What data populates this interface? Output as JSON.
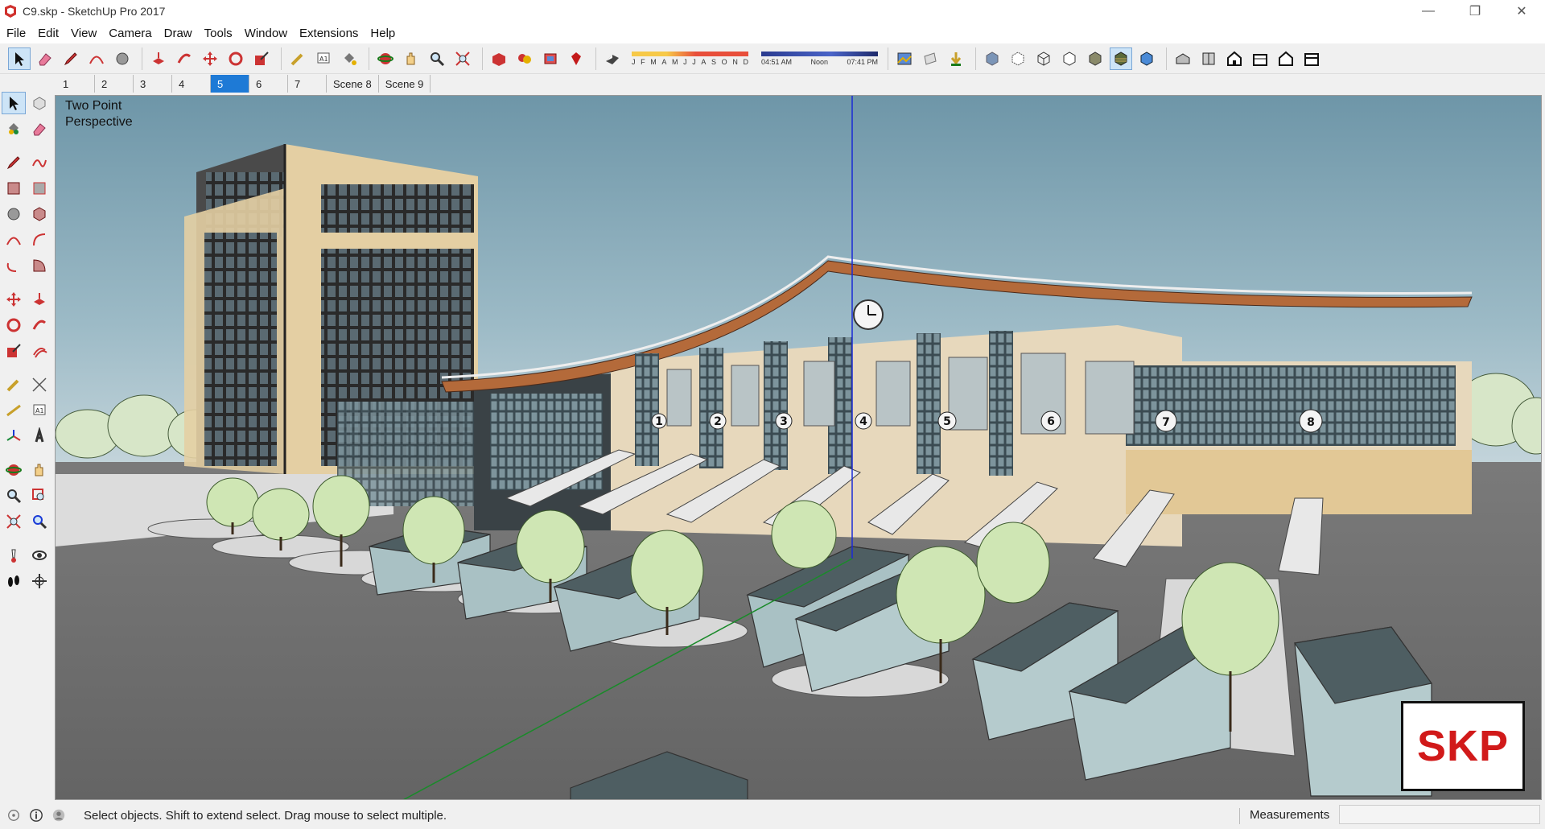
{
  "window": {
    "title": "C9.skp - SketchUp Pro 2017",
    "minimize": "—",
    "restore": "❐",
    "close": "✕"
  },
  "menu": [
    "File",
    "Edit",
    "View",
    "Camera",
    "Draw",
    "Tools",
    "Window",
    "Extensions",
    "Help"
  ],
  "shadows": {
    "months": [
      "J",
      "F",
      "M",
      "A",
      "M",
      "J",
      "J",
      "A",
      "S",
      "O",
      "N",
      "D"
    ],
    "time_start": "04:51 AM",
    "time_mid": "Noon",
    "time_end": "07:41 PM"
  },
  "scenes": {
    "tabs": [
      "1",
      "2",
      "3",
      "4",
      "5",
      "6",
      "7",
      "Scene 8",
      "Scene 9"
    ],
    "active": "5"
  },
  "viewport": {
    "camera_label_line1": "Two Point",
    "camera_label_line2": "Perspective",
    "logo_text": "SKP",
    "gate_numbers": [
      "1",
      "2",
      "3",
      "4",
      "5",
      "6",
      "7",
      "8"
    ]
  },
  "status": {
    "message": "Select objects. Shift to extend select. Drag mouse to select multiple.",
    "measurements_label": "Measurements",
    "measurements_value": ""
  },
  "colors": {
    "sky": "#7fa3b3",
    "ground": "#6e6e6e",
    "building": "#e6d7b8",
    "accent_blue": "#1e7ad6",
    "logo_red": "#d11a1a"
  }
}
